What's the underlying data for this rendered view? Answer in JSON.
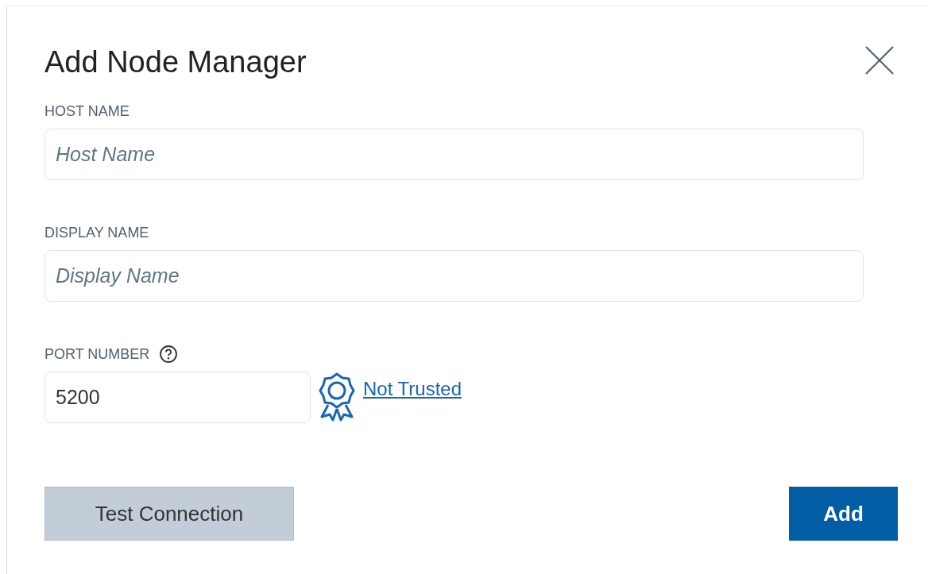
{
  "dialog": {
    "title": "Add Node Manager"
  },
  "fields": [
    {
      "label": "HOST NAME",
      "placeholder": "Host Name"
    },
    {
      "label": "DISPLAY NAME",
      "placeholder": "Display Name"
    },
    {
      "label": "PORT NUMBER",
      "value": "5200",
      "help": true,
      "link": "Not Trusted"
    }
  ],
  "buttons": [
    {
      "label": "Test Connection",
      "kind": "secondary"
    },
    {
      "label": "Add",
      "kind": "primary"
    }
  ]
}
